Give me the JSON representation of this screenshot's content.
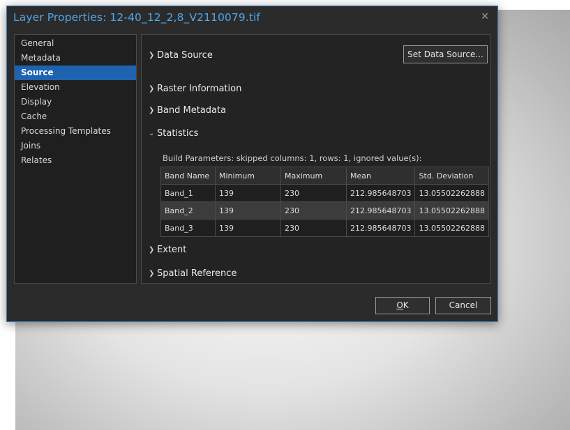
{
  "window": {
    "title": "Layer Properties: 12-40_12_2,8_V2110079.tif"
  },
  "nav": {
    "items": [
      {
        "label": "General",
        "active": false
      },
      {
        "label": "Metadata",
        "active": false
      },
      {
        "label": "Source",
        "active": true
      },
      {
        "label": "Elevation",
        "active": false
      },
      {
        "label": "Display",
        "active": false
      },
      {
        "label": "Cache",
        "active": false
      },
      {
        "label": "Processing Templates",
        "active": false
      },
      {
        "label": "Joins",
        "active": false
      },
      {
        "label": "Relates",
        "active": false
      }
    ]
  },
  "sections": {
    "data_source": "Data Source",
    "raster_information": "Raster Information",
    "band_metadata": "Band Metadata",
    "statistics": "Statistics",
    "extent": "Extent",
    "spatial_reference": "Spatial Reference"
  },
  "buttons": {
    "set_data_source": "Set Data Source...",
    "ok_mnemonic": "O",
    "ok_rest": "K",
    "cancel": "Cancel"
  },
  "statistics": {
    "build_parameters": "Build Parameters: skipped columns: 1, rows: 1, ignored value(s):",
    "columns": [
      "Band Name",
      "Minimum",
      "Maximum",
      "Mean",
      "Std. Deviation"
    ],
    "rows": [
      [
        "Band_1",
        "139",
        "230",
        "212.985648703",
        "13.05502262888"
      ],
      [
        "Band_2",
        "139",
        "230",
        "212.985648703",
        "13.05502262888"
      ],
      [
        "Band_3",
        "139",
        "230",
        "212.985648703",
        "13.05502262888"
      ]
    ],
    "selected_row": 1
  },
  "icons": {
    "close": "close-icon",
    "collapsed": "chevron-right-icon",
    "expanded": "chevron-down-icon"
  },
  "colors": {
    "title": "#52a6e8",
    "selection": "#1d63b0",
    "dialog_bg": "#2b2b2b",
    "border_accent": "#3c78b4"
  }
}
